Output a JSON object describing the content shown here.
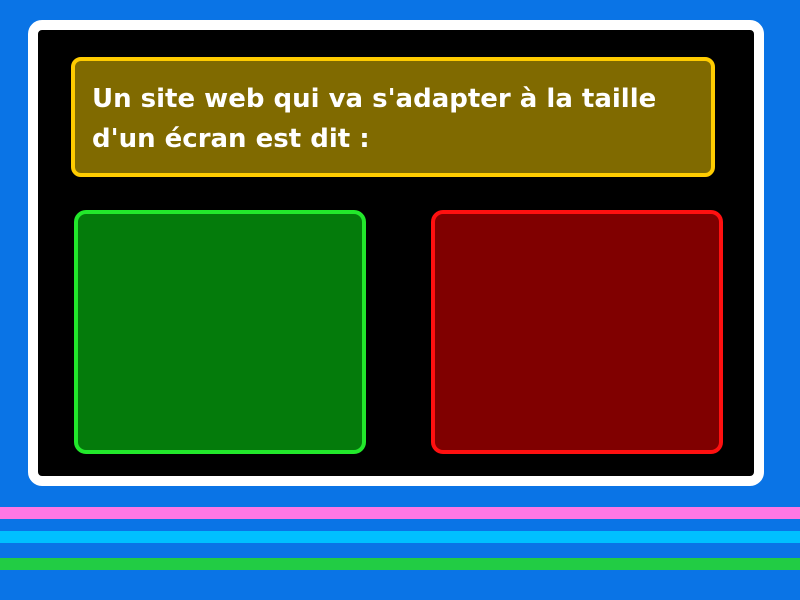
{
  "question": {
    "text": "Un site web qui va s'adapter à la taille d'un écran est dit :"
  },
  "answers": [
    {
      "label": "",
      "color": "#047b0b",
      "border": "#22e82b"
    },
    {
      "label": "",
      "color": "#800000",
      "border": "#ff1010"
    }
  ],
  "theme": {
    "background": "#0a74e6",
    "frame": "#000000",
    "frame_border": "#ffffff",
    "question_bg": "#806a00",
    "question_border": "#ffcc00",
    "stripes": [
      "#ff77e4",
      "#00c0ff",
      "#22cc44"
    ]
  }
}
